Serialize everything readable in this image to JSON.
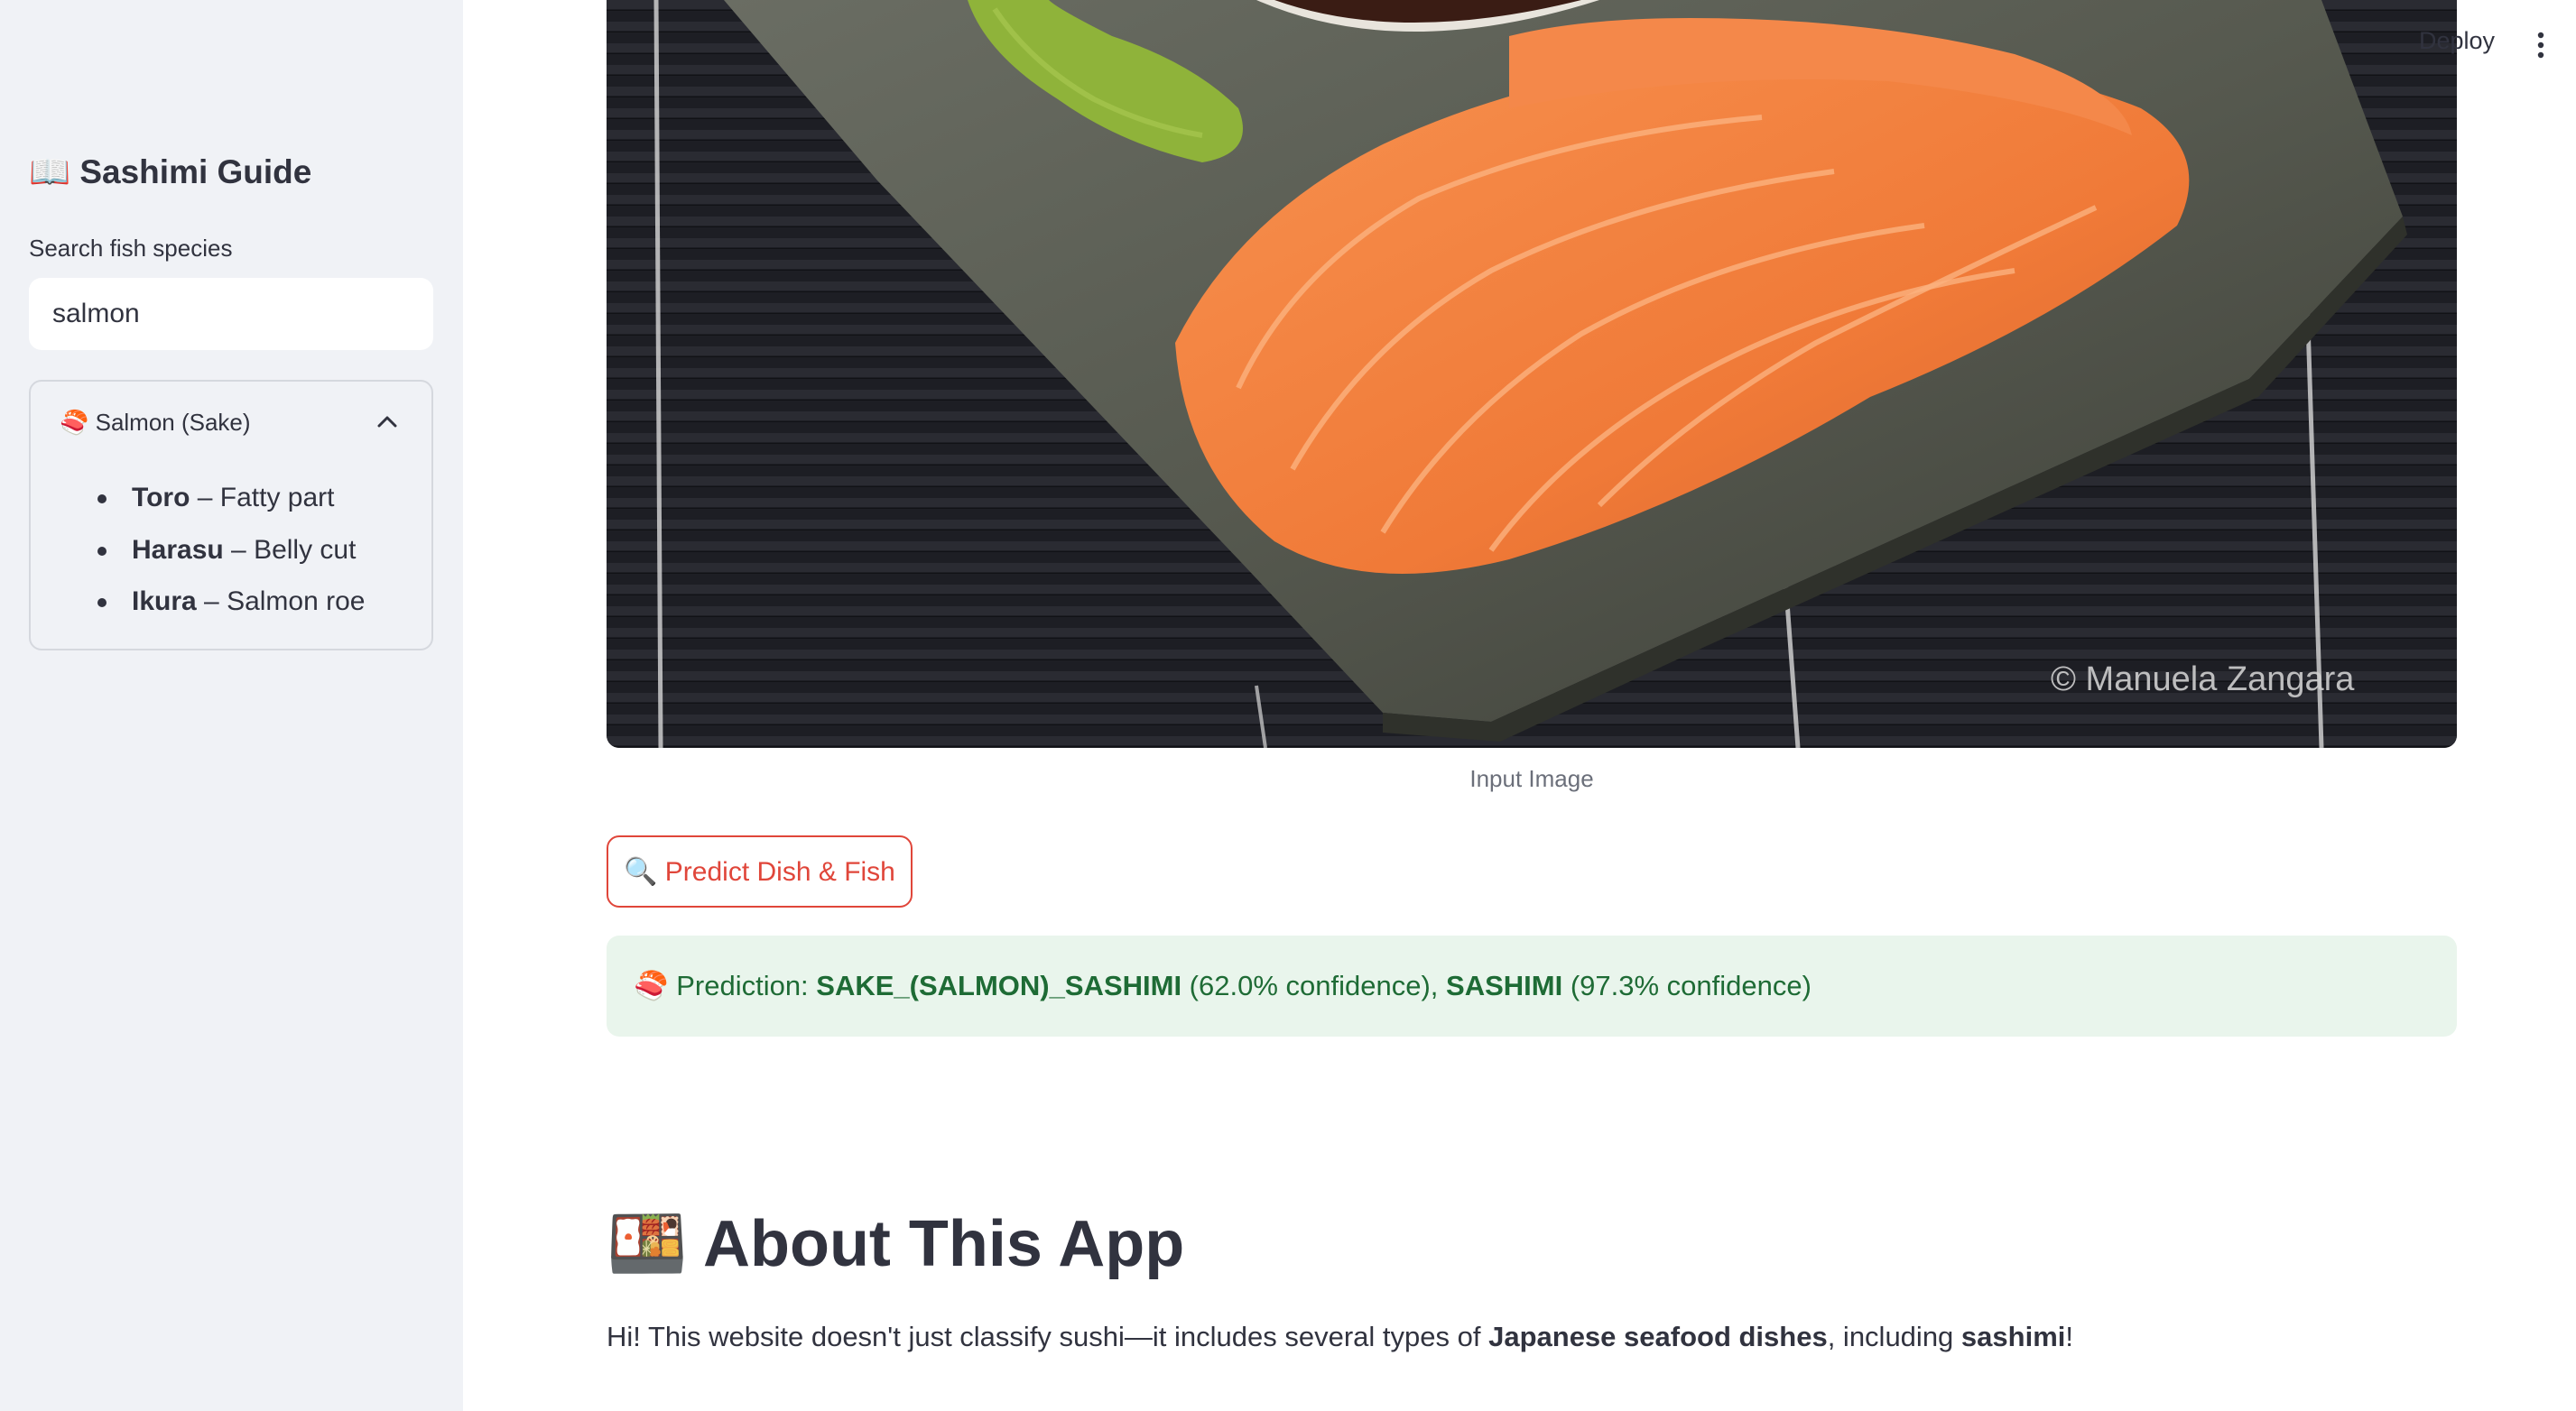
{
  "sidebar": {
    "title": "📖 Sashimi Guide",
    "search_label": "Search fish species",
    "search_value": "salmon",
    "expander": {
      "title": "🍣 Salmon (Sake)",
      "items": [
        {
          "name": "Toro",
          "desc": " – Fatty part"
        },
        {
          "name": "Harasu",
          "desc": " – Belly cut"
        },
        {
          "name": "Ikura",
          "desc": " – Salmon roe"
        }
      ]
    }
  },
  "toolbar": {
    "deploy_label": "Deploy"
  },
  "main": {
    "image_watermark": "© Manuela Zangara",
    "image_caption": "Input Image",
    "predict_button_label": "🔍 Predict Dish & Fish",
    "prediction": {
      "prefix": "🍣 Prediction: ",
      "fish_label": "SAKE_(SALMON)_SASHIMI",
      "fish_confidence": " (62.0% confidence), ",
      "dish_label": "SASHIMI",
      "dish_confidence": " (97.3% confidence)"
    },
    "about": {
      "title": "🍱 About This App",
      "text_1": "Hi! This website doesn't just classify sushi—it includes several types of ",
      "bold_1": "Japanese seafood dishes",
      "text_2": ", including ",
      "bold_2": "sashimi",
      "text_3": "!"
    }
  },
  "colors": {
    "sidebar_bg": "#f0f2f6",
    "accent_red": "#e0463a",
    "success_bg": "#e9f5ec",
    "success_text": "#1e6b35",
    "text": "#31333f"
  }
}
